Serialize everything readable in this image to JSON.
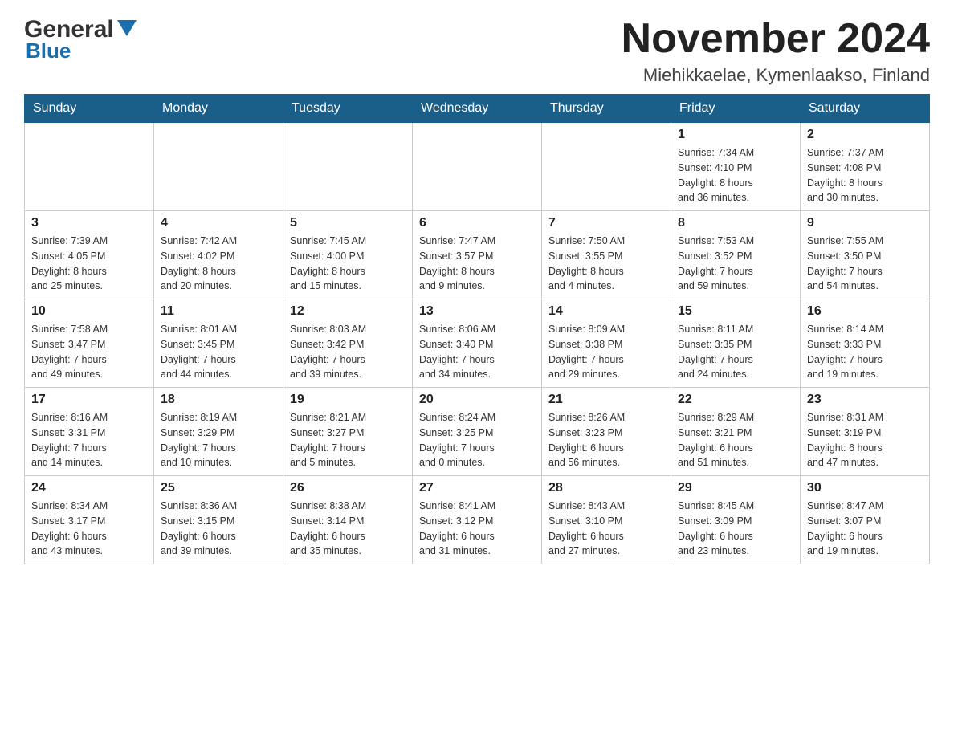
{
  "header": {
    "logo_general": "General",
    "logo_blue": "Blue",
    "title": "November 2024",
    "location": "Miehikkaelae, Kymenlaakso, Finland"
  },
  "calendar": {
    "days_of_week": [
      "Sunday",
      "Monday",
      "Tuesday",
      "Wednesday",
      "Thursday",
      "Friday",
      "Saturday"
    ],
    "weeks": [
      [
        {
          "day": "",
          "info": ""
        },
        {
          "day": "",
          "info": ""
        },
        {
          "day": "",
          "info": ""
        },
        {
          "day": "",
          "info": ""
        },
        {
          "day": "",
          "info": ""
        },
        {
          "day": "1",
          "info": "Sunrise: 7:34 AM\nSunset: 4:10 PM\nDaylight: 8 hours\nand 36 minutes."
        },
        {
          "day": "2",
          "info": "Sunrise: 7:37 AM\nSunset: 4:08 PM\nDaylight: 8 hours\nand 30 minutes."
        }
      ],
      [
        {
          "day": "3",
          "info": "Sunrise: 7:39 AM\nSunset: 4:05 PM\nDaylight: 8 hours\nand 25 minutes."
        },
        {
          "day": "4",
          "info": "Sunrise: 7:42 AM\nSunset: 4:02 PM\nDaylight: 8 hours\nand 20 minutes."
        },
        {
          "day": "5",
          "info": "Sunrise: 7:45 AM\nSunset: 4:00 PM\nDaylight: 8 hours\nand 15 minutes."
        },
        {
          "day": "6",
          "info": "Sunrise: 7:47 AM\nSunset: 3:57 PM\nDaylight: 8 hours\nand 9 minutes."
        },
        {
          "day": "7",
          "info": "Sunrise: 7:50 AM\nSunset: 3:55 PM\nDaylight: 8 hours\nand 4 minutes."
        },
        {
          "day": "8",
          "info": "Sunrise: 7:53 AM\nSunset: 3:52 PM\nDaylight: 7 hours\nand 59 minutes."
        },
        {
          "day": "9",
          "info": "Sunrise: 7:55 AM\nSunset: 3:50 PM\nDaylight: 7 hours\nand 54 minutes."
        }
      ],
      [
        {
          "day": "10",
          "info": "Sunrise: 7:58 AM\nSunset: 3:47 PM\nDaylight: 7 hours\nand 49 minutes."
        },
        {
          "day": "11",
          "info": "Sunrise: 8:01 AM\nSunset: 3:45 PM\nDaylight: 7 hours\nand 44 minutes."
        },
        {
          "day": "12",
          "info": "Sunrise: 8:03 AM\nSunset: 3:42 PM\nDaylight: 7 hours\nand 39 minutes."
        },
        {
          "day": "13",
          "info": "Sunrise: 8:06 AM\nSunset: 3:40 PM\nDaylight: 7 hours\nand 34 minutes."
        },
        {
          "day": "14",
          "info": "Sunrise: 8:09 AM\nSunset: 3:38 PM\nDaylight: 7 hours\nand 29 minutes."
        },
        {
          "day": "15",
          "info": "Sunrise: 8:11 AM\nSunset: 3:35 PM\nDaylight: 7 hours\nand 24 minutes."
        },
        {
          "day": "16",
          "info": "Sunrise: 8:14 AM\nSunset: 3:33 PM\nDaylight: 7 hours\nand 19 minutes."
        }
      ],
      [
        {
          "day": "17",
          "info": "Sunrise: 8:16 AM\nSunset: 3:31 PM\nDaylight: 7 hours\nand 14 minutes."
        },
        {
          "day": "18",
          "info": "Sunrise: 8:19 AM\nSunset: 3:29 PM\nDaylight: 7 hours\nand 10 minutes."
        },
        {
          "day": "19",
          "info": "Sunrise: 8:21 AM\nSunset: 3:27 PM\nDaylight: 7 hours\nand 5 minutes."
        },
        {
          "day": "20",
          "info": "Sunrise: 8:24 AM\nSunset: 3:25 PM\nDaylight: 7 hours\nand 0 minutes."
        },
        {
          "day": "21",
          "info": "Sunrise: 8:26 AM\nSunset: 3:23 PM\nDaylight: 6 hours\nand 56 minutes."
        },
        {
          "day": "22",
          "info": "Sunrise: 8:29 AM\nSunset: 3:21 PM\nDaylight: 6 hours\nand 51 minutes."
        },
        {
          "day": "23",
          "info": "Sunrise: 8:31 AM\nSunset: 3:19 PM\nDaylight: 6 hours\nand 47 minutes."
        }
      ],
      [
        {
          "day": "24",
          "info": "Sunrise: 8:34 AM\nSunset: 3:17 PM\nDaylight: 6 hours\nand 43 minutes."
        },
        {
          "day": "25",
          "info": "Sunrise: 8:36 AM\nSunset: 3:15 PM\nDaylight: 6 hours\nand 39 minutes."
        },
        {
          "day": "26",
          "info": "Sunrise: 8:38 AM\nSunset: 3:14 PM\nDaylight: 6 hours\nand 35 minutes."
        },
        {
          "day": "27",
          "info": "Sunrise: 8:41 AM\nSunset: 3:12 PM\nDaylight: 6 hours\nand 31 minutes."
        },
        {
          "day": "28",
          "info": "Sunrise: 8:43 AM\nSunset: 3:10 PM\nDaylight: 6 hours\nand 27 minutes."
        },
        {
          "day": "29",
          "info": "Sunrise: 8:45 AM\nSunset: 3:09 PM\nDaylight: 6 hours\nand 23 minutes."
        },
        {
          "day": "30",
          "info": "Sunrise: 8:47 AM\nSunset: 3:07 PM\nDaylight: 6 hours\nand 19 minutes."
        }
      ]
    ]
  }
}
